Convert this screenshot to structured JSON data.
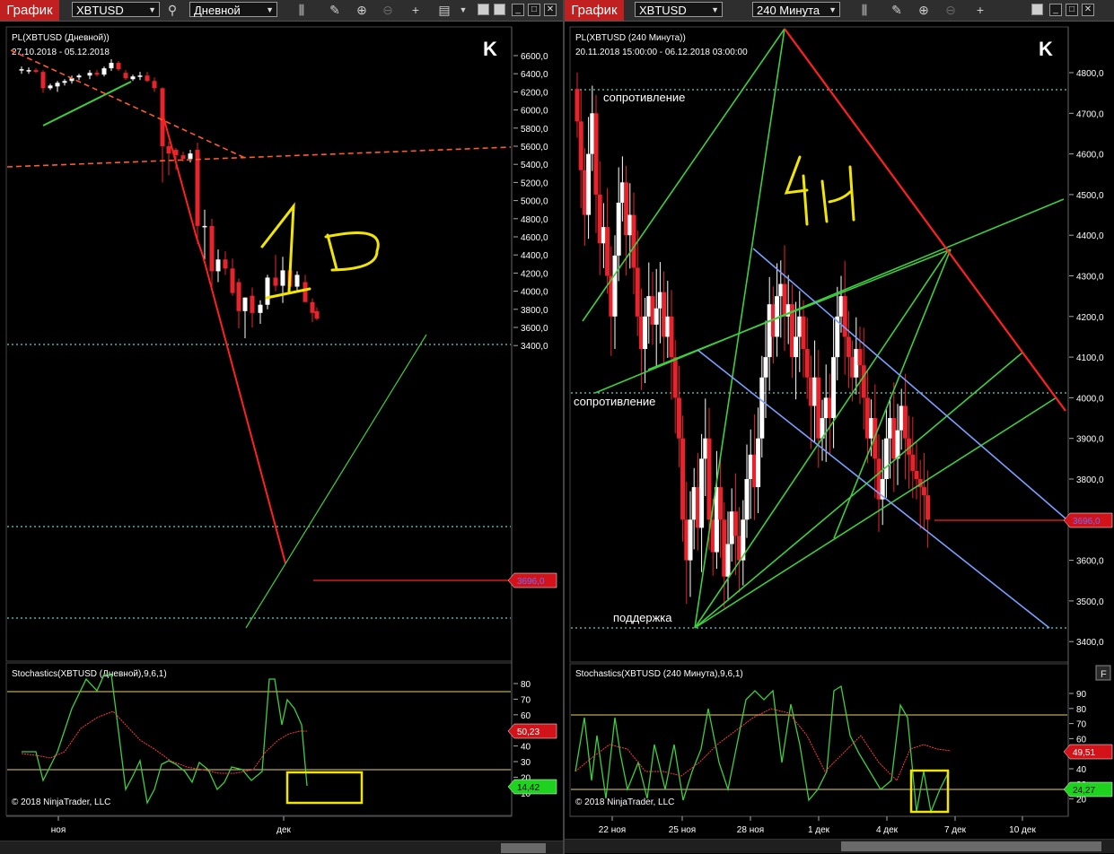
{
  "left": {
    "toolbar": {
      "brand": "График",
      "symbol": "XBTUSD",
      "timeframe": "Дневной"
    },
    "main": {
      "title": "PL(XBTUSD (Дневной))",
      "range": "27.10.2018 - 05.12.2018",
      "annotation": "1D",
      "price_axis": [
        "6600,0",
        "6400,0",
        "6200,0",
        "6000,0",
        "5800,0",
        "5600,0",
        "5400,0",
        "5200,0",
        "5000,0",
        "4800,0",
        "4600,0",
        "4400,0",
        "4200,0",
        "4000,0",
        "3800,0",
        "3600,0",
        "3400,0"
      ],
      "last_price": "3696,0"
    },
    "stoch": {
      "title": "Stochastics(XBTUSD (Дневной),9,6,1)",
      "axis": [
        "80",
        "70",
        "60",
        "50",
        "40",
        "30",
        "20",
        "10"
      ],
      "d_value": "50,23",
      "k_value": "14,42",
      "copyright": "© 2018 NinjaTrader, LLC"
    },
    "dates": [
      "ноя",
      "дек"
    ]
  },
  "right": {
    "toolbar": {
      "brand": "График",
      "symbol": "XBTUSD",
      "timeframe": "240 Минута"
    },
    "main": {
      "title": "PL(XBTUSD (240 Минута))",
      "range": "20.11.2018 15:00:00 - 06.12.2018 03:00:00",
      "annotation": "4H",
      "resistance_top": "сопротивление",
      "resistance_mid": "сопротивление",
      "support": "поддержка",
      "price_axis": [
        "4800,0",
        "4700,0",
        "4600,0",
        "4500,0",
        "4400,0",
        "4300,0",
        "4200,0",
        "4100,0",
        "4000,0",
        "3900,0",
        "3800,0",
        "3700,0",
        "3600,0",
        "3500,0",
        "3400,0"
      ],
      "last_price": "3696,0"
    },
    "stoch": {
      "title": "Stochastics(XBTUSD (240 Минута),9,6,1)",
      "axis": [
        "90",
        "80",
        "70",
        "60",
        "50",
        "40",
        "30",
        "20"
      ],
      "d_value": "49,51",
      "k_value": "24,27",
      "copyright": "© 2018 NinjaTrader, LLC",
      "panel_button": "F"
    },
    "dates": [
      "22 ноя",
      "25 ноя",
      "28 ноя",
      "1 дек",
      "4 дек",
      "7 дек",
      "10 дек"
    ]
  },
  "colors": {
    "up": "#ffffff",
    "down": "#e8232b",
    "green_line": "#3ecf3e",
    "red_line": "#ff2020",
    "blue_line": "#7b9fff",
    "dotted": "#5fd1c5",
    "yellow": "#f2e600"
  }
}
